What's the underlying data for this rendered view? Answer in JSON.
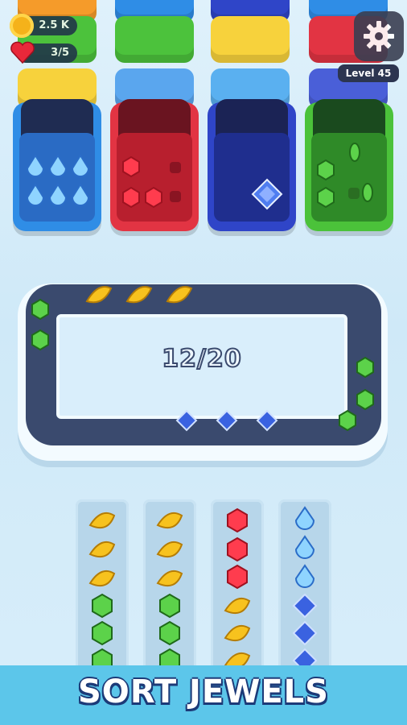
{
  "hud": {
    "coins": "2.5 K",
    "lives": "3/5",
    "level": "Level 45",
    "coin_icon": "coin-icon",
    "heart_icon": "heart-icon",
    "settings_icon": "gear-icon"
  },
  "counter": "12/20",
  "banner": "SORT JEWELS",
  "colors": {
    "blue": "#2f8de6",
    "red": "#e23443",
    "navy": "#2f45c8",
    "green": "#4bc23a",
    "yellow": "#f7d23c",
    "track": "#3a4a6e"
  }
}
